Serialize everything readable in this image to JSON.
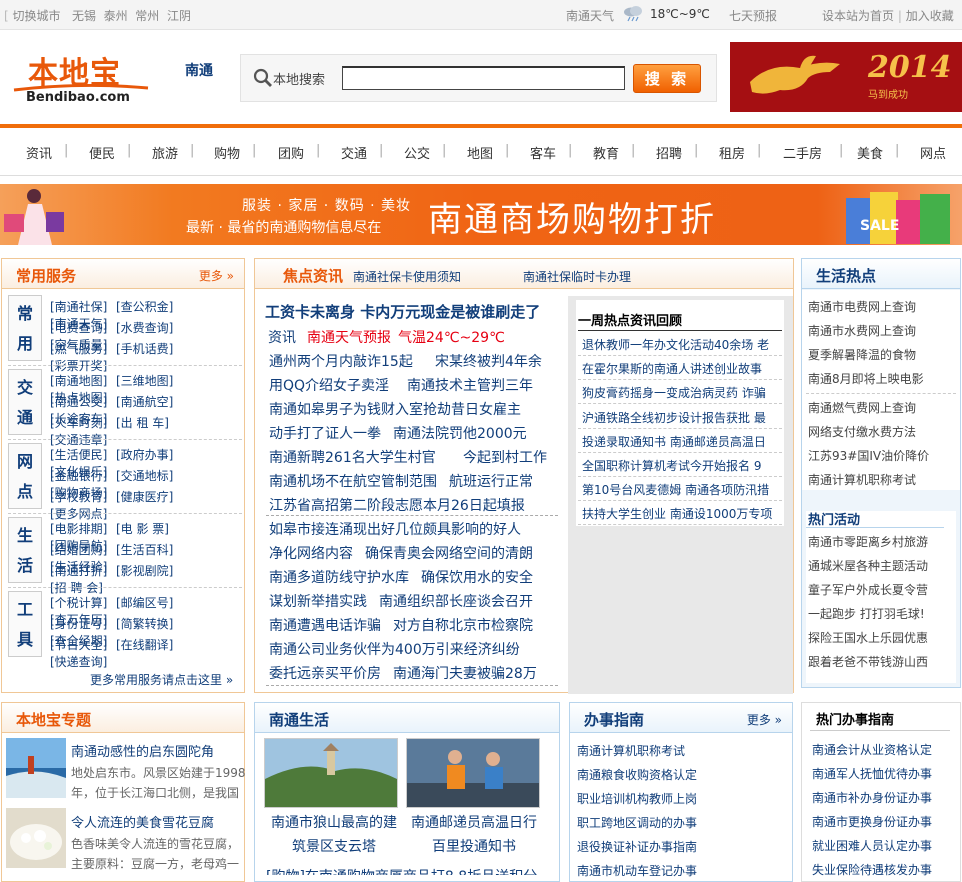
{
  "topbar": {
    "switch_label": "切换城市",
    "cities": [
      "无锡",
      "泰州",
      "常州",
      "江阴"
    ],
    "weather_label": "南通天气",
    "temp": "18℃~9℃",
    "forecast": "七天预报",
    "homepage": "设本站为首页",
    "favorite": "加入收藏"
  },
  "header": {
    "logo_cn": "本地宝",
    "logo_en": "Bendibao.com",
    "city": "南通",
    "search_label": "本地搜索",
    "search_value": "",
    "search_button": "搜 索",
    "ad_year": "2014",
    "ad_sub": "马到成功"
  },
  "nav": [
    "资讯",
    "便民",
    "旅游",
    "购物",
    "团购",
    "交通",
    "公交",
    "地图",
    "客车",
    "教育",
    "招聘",
    "租房",
    "二手房",
    "美食",
    "网点"
  ],
  "banner": {
    "line1": "服装 · 家居 · 数码 · 美妆",
    "line2": "最新 · 最省的南通购物信息尽在",
    "title": "南通商场购物打折",
    "sale": "SALE"
  },
  "services": {
    "title": "常用服务",
    "more": "更多",
    "footer": "更多常用服务请点击这里",
    "groups": [
      {
        "cat": [
          "常",
          "用"
        ],
        "rows": [
          [
            "[南通社保]",
            "[查公积金]",
            "[南通天气]"
          ],
          [
            "[电费查询]",
            "[水费查询]",
            "[空气质量]"
          ],
          [
            "[燃气服务]",
            "[手机话费]",
            "[彩票开奖]"
          ]
        ]
      },
      {
        "cat": [
          "交",
          "通"
        ],
        "rows": [
          [
            "[南通地图]",
            "[三维地图]",
            "[热点地图]"
          ],
          [
            "[南通公交]",
            "[南通航空]",
            "[长途客车]"
          ],
          [
            "[火车时刻]",
            "[出 租 车]",
            "[交通违章]"
          ]
        ]
      },
      {
        "cat": [
          "网",
          "点"
        ],
        "rows": [
          [
            "[生活便民]",
            "[政府办事]",
            "[文化娱乐]"
          ],
          [
            "[金融银行]",
            "[交通地标]",
            "[购物商场]"
          ],
          [
            "[学校教育]",
            "[健康医疗]",
            "[更多网点]"
          ]
        ]
      },
      {
        "cat": [
          "生",
          "活"
        ],
        "rows": [
          [
            "[电影排期]",
            "[电 影 票]",
            "[团购导航]"
          ],
          [
            "[结婚团购]",
            "[生活百科]",
            "[生活经验]"
          ],
          [
            "[南通打折]",
            "[影视剧院]",
            "[招 聘 会]"
          ]
        ]
      },
      {
        "cat": [
          "工",
          "具"
        ],
        "rows": [
          [
            "[个税计算]",
            "[邮编区号]",
            "[查万年历]"
          ],
          [
            "[身份证号]",
            "[简繁转换]",
            "[查全经期]"
          ],
          [
            "[节日大全]",
            "[在线翻译]",
            "[快递查询]"
          ]
        ]
      }
    ]
  },
  "focus": {
    "title": "焦点资讯",
    "tab1": "南通社保卡使用须知",
    "tab2": "南通社保临时卡办理",
    "headline": "工资卡未离身 卡内万元现金是被谁刷走了",
    "sub_a": "资讯",
    "sub_b": "南通天气预报",
    "sub_c": "气温24℃~29℃",
    "items": [
      [
        "通州两个月内敲诈15起",
        "宋某终被判4年余"
      ],
      [
        "用QQ介绍女子卖淫",
        "南通技术主管判三年"
      ],
      [
        "南通如皋男子为钱财入室抢劫昔日女雇主"
      ],
      [
        "动手打了证人一拳",
        "南通法院罚他2000元"
      ],
      [
        "南通新聘261名大学生村官",
        "今起到村工作"
      ],
      [
        "南通机场不在航空管制范围",
        "航班运行正常"
      ],
      [
        "江苏省高招第二阶段志愿本月26日起填报"
      ],
      [
        "如皋市接连涌现出好几位颇具影响的好人"
      ],
      [
        "净化网络内容",
        "确保青奥会网络空间的清朗"
      ],
      [
        "南通多道防线守护水库",
        "确保饮用水的安全"
      ],
      [
        "谋划新举措实践",
        "南通组织部长座谈会召开"
      ],
      [
        "南通遭遇电话诈骗",
        "对方自称北京市检察院"
      ],
      [
        "南通公司业务伙伴为400万引来经济纠纷"
      ],
      [
        "委托远亲买平价房",
        "南通海门夫妻被骗28万"
      ]
    ]
  },
  "weekly": {
    "title": "一周热点资讯回顾",
    "items": [
      "退休教师一年办文化活动40余场 老",
      "在霍尔果斯的南通人讲述创业故事",
      "狗皮膏药摇身一变成治病灵药 诈骗",
      "沪通铁路全线初步设计报告获批 最",
      "投递录取通知书 南通邮递员高温日",
      "全国职称计算机考试今开始报名 9",
      "第10号台风麦德姆 南通各项防汛措",
      "扶持大学生创业 南通设1000万专项"
    ]
  },
  "life_hot": {
    "title": "生活热点",
    "items1": [
      "南通市电费网上查询",
      "南通市水费网上查询",
      "夏季解暑降温的食物",
      "南通8月即将上映电影"
    ],
    "items2": [
      "南通燃气费网上查询",
      "网络支付缴水费方法",
      "江苏93#国IV油价降价",
      "南通计算机职称考试"
    ],
    "activity_title": "热门活动",
    "activities": [
      "南通市零距离乡村旅游",
      "通城米屋各种主题活动",
      "童子军户外成长夏令营",
      "一起跑步 打打羽毛球!",
      "探险王国水上乐园优惠",
      "跟着老爸不带钱游山西"
    ]
  },
  "special": {
    "title": "本地宝专题",
    "items": [
      {
        "title": "南通动感性的启东圆陀角",
        "desc1": "地处启东市。风景区始建于1998",
        "desc2": "年，位于长江海口北侧，是我国"
      },
      {
        "title": "令人流连的美食雪花豆腐",
        "desc1": "色香味美令人流连的雪花豆腐，",
        "desc2": "主要原料：豆腐一方，老母鸡一"
      }
    ]
  },
  "nt_life": {
    "title": "南通生活",
    "cards": [
      {
        "l1": "南通市狼山最高的建",
        "l2": "筑景区支云塔"
      },
      {
        "l1": "南通邮递员高温日行",
        "l2": "百里投通知书"
      }
    ],
    "bottom": "[购物]在南通购物商厦商品打8.8折且送积分"
  },
  "guide": {
    "title": "办事指南",
    "more": "更多",
    "items": [
      "南通计算机职称考试",
      "南通粮食收购资格认定",
      "职业培训机构教师上岗",
      "职工跨地区调动的办事",
      "退役换证补证办事指南",
      "南通市机动车登记办事"
    ]
  },
  "hot_guide": {
    "title": "热门办事指南",
    "items": [
      "南通会计从业资格认定",
      "南通军人抚恤优待办事",
      "南通市补办身份证办事",
      "南通市更换身份证办事",
      "就业困难人员认定办事",
      "失业保险待遇核发办事"
    ]
  }
}
